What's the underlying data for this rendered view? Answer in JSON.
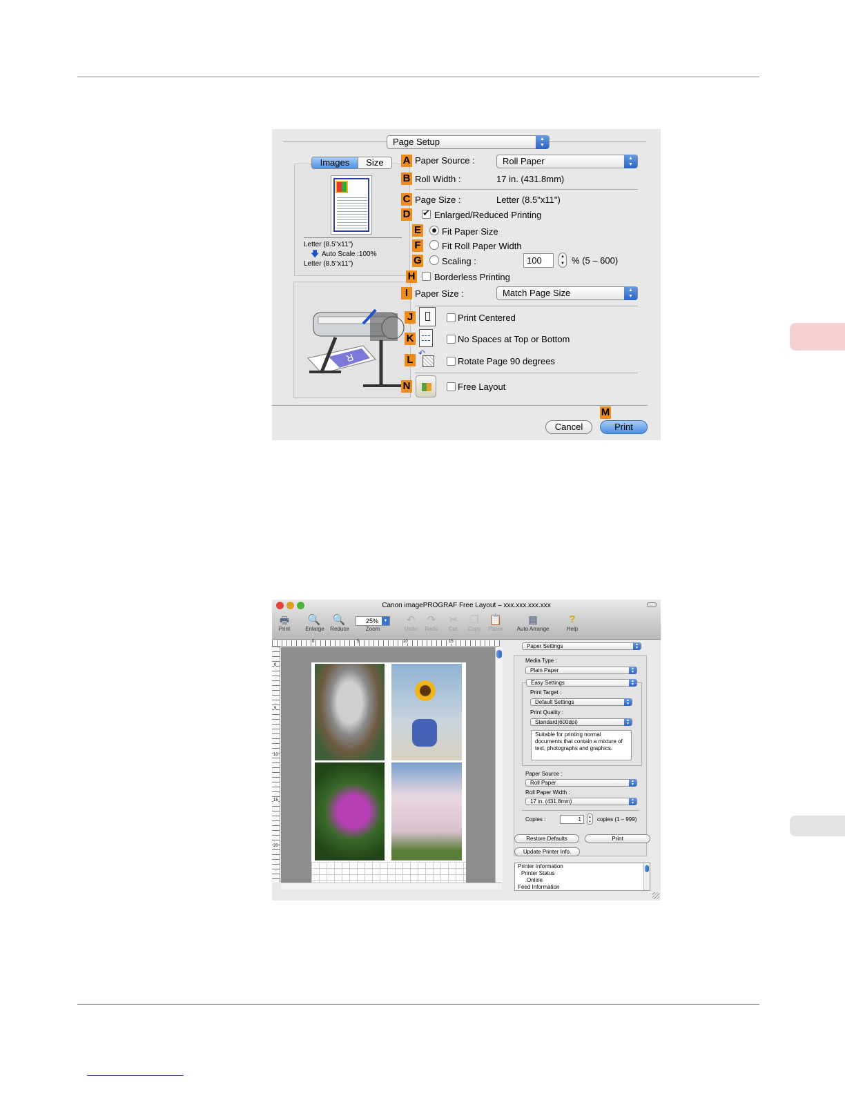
{
  "page_setup": {
    "dialog_title": "Page Setup",
    "tabs": [
      "Images",
      "Size"
    ],
    "preview": {
      "line1": "Letter (8.5\"x11\")",
      "line2": "Auto Scale :100%",
      "line3": "Letter (8.5\"x11\")"
    },
    "letters": {
      "A": "A",
      "B": "B",
      "C": "C",
      "D": "D",
      "E": "E",
      "F": "F",
      "G": "G",
      "H": "H",
      "I": "I",
      "J": "J",
      "K": "K",
      "L": "L",
      "M": "M",
      "N": "N"
    },
    "paper_source_label": "Paper Source :",
    "paper_source_value": "Roll Paper",
    "roll_width_label": "Roll Width :",
    "roll_width_value": "17 in. (431.8mm)",
    "page_size_label": "Page Size :",
    "page_size_value": "Letter (8.5\"x11\")",
    "enlarged_label": "Enlarged/Reduced Printing",
    "enlarged_checked": true,
    "fit_paper_label": "Fit Paper Size",
    "fit_roll_label": "Fit Roll Paper Width",
    "scaling_label": "Scaling :",
    "scaling_value": "100",
    "scaling_range": "% (5 – 600)",
    "borderless_label": "Borderless Printing",
    "paper_size_label": "Paper Size :",
    "paper_size_value": "Match Page Size",
    "print_centered_label": "Print Centered",
    "no_spaces_label": "No Spaces at Top or Bottom",
    "rotate_label": "Rotate Page 90 degrees",
    "free_layout_label": "Free Layout",
    "cancel_label": "Cancel",
    "print_label": "Print"
  },
  "free_layout": {
    "window_title": "Canon imagePROGRAF Free Layout – xxx.xxx.xxx.xxx",
    "toolbar": [
      "Print",
      "Enlarge",
      "Reduce",
      "Zoom",
      "Undo",
      "Redo",
      "Cut",
      "Copy",
      "Paste",
      "Auto Arrange",
      "Help"
    ],
    "zoom_value": "25%",
    "ruler_ticks": [
      "0",
      "5",
      "10",
      "15"
    ],
    "ruler_v_ticks": [
      "0",
      "5",
      "10",
      "15",
      "20"
    ],
    "panel_select": "Paper Settings",
    "media_type_label": "Media Type :",
    "media_type_value": "Plain Paper",
    "easy_settings": "Easy Settings",
    "print_target_label": "Print Target :",
    "print_target_value": "Default Settings",
    "print_quality_label": "Print Quality :",
    "print_quality_value": "Standard(600dpi)",
    "description": "Suitable for printing normal documents that contain a mixture of text, photographs and graphics.",
    "paper_source_label": "Paper Source :",
    "paper_source_value": "Roll Paper",
    "roll_width_label": "Roll Paper Width :",
    "roll_width_value": "17 in. (431.8mm)",
    "copies_label": "Copies :",
    "copies_value": "1",
    "copies_range": "copies (1 – 999)",
    "restore_label": "Restore Defaults",
    "print_label": "Print",
    "update_label": "Update Printer Info.",
    "info_lines": [
      "Printer Information",
      "Printer Status",
      "Online",
      "Feed Information"
    ]
  },
  "colors": {
    "accent_orange": "#f08c1e",
    "side_tab": "#f6d0cf",
    "aqua_blue": "#4b8fe2"
  }
}
